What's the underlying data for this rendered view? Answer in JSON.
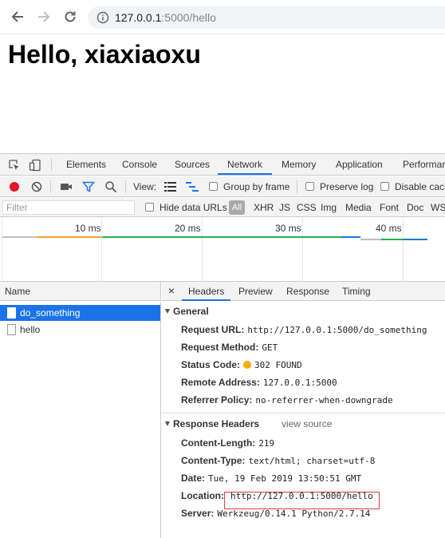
{
  "browser": {
    "url_host": "127.0.0.1",
    "url_path": ":5000/hello"
  },
  "page": {
    "heading": "Hello, xiaxiaoxu"
  },
  "devtools": {
    "tabs": [
      "Elements",
      "Console",
      "Sources",
      "Network",
      "Memory",
      "Application",
      "Performan"
    ],
    "active_tab": "Network",
    "toolbar": {
      "view_label": "View:",
      "group_by_frame": "Group by frame",
      "preserve_log": "Preserve log",
      "disable_cache": "Disable cach"
    },
    "filter": {
      "placeholder": "Filter",
      "hide_data_urls": "Hide data URLs",
      "types": [
        "All",
        "XHR",
        "JS",
        "CSS",
        "Img",
        "Media",
        "Font",
        "Doc",
        "WS"
      ]
    },
    "overview_ticks": [
      "10 ms",
      "20 ms",
      "30 ms",
      "40 ms"
    ],
    "requests": {
      "column_name": "Name",
      "items": [
        {
          "name": "do_something",
          "selected": true
        },
        {
          "name": "hello",
          "selected": false
        }
      ]
    },
    "details": {
      "close": "×",
      "tabs": [
        "Headers",
        "Preview",
        "Response",
        "Timing"
      ],
      "active_tab": "Headers",
      "general": {
        "title": "General",
        "request_url_label": "Request URL:",
        "request_url": "http://127.0.0.1:5000/do_something",
        "request_method_label": "Request Method:",
        "request_method": "GET",
        "status_code_label": "Status Code:",
        "status_code": "302 FOUND",
        "remote_address_label": "Remote Address:",
        "remote_address": "127.0.0.1:5000",
        "referrer_policy_label": "Referrer Policy:",
        "referrer_policy": "no-referrer-when-downgrade"
      },
      "response_headers": {
        "title": "Response Headers",
        "view_source": "view source",
        "content_length_label": "Content-Length:",
        "content_length": "219",
        "content_type_label": "Content-Type:",
        "content_type": "text/html; charset=utf-8",
        "date_label": "Date:",
        "date": "Tue, 19 Feb 2019 13:50:51 GMT",
        "location_label": "Location:",
        "location": "http://127.0.0.1:5000/hello",
        "server_label": "Server:",
        "server": "Werkzeug/0.14.1 Python/2.7.14"
      }
    }
  },
  "colors": {
    "accent": "#1a73e8",
    "record": "#e8132c",
    "status_warning": "#f9ab00",
    "highlight_box": "#e53935"
  }
}
